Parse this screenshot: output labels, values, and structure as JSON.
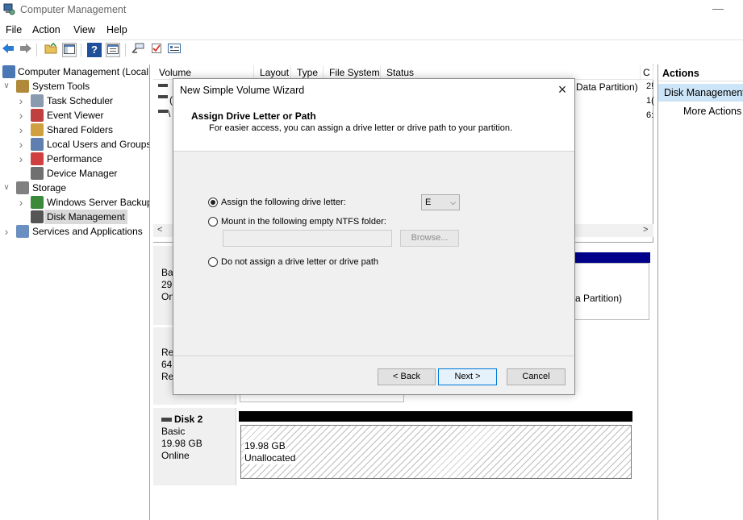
{
  "window": {
    "title": "Computer Management",
    "minimize": "—"
  },
  "menu": [
    "File",
    "Action",
    "View",
    "Help"
  ],
  "toolbar": {
    "back": "back-arrow-icon",
    "forward": "forward-arrow-icon",
    "up": "up-folder-icon",
    "show_tree": "console-tree-icon",
    "help": "help-icon",
    "view": "view-icon",
    "connect": "connect-icon",
    "check": "checklist-icon",
    "properties": "properties-icon",
    "help_glyph": "?"
  },
  "tree": {
    "root": "Computer Management (Local",
    "items": [
      {
        "label": "System Tools",
        "level": 1,
        "arrow": "v"
      },
      {
        "label": "Task Scheduler",
        "level": 2,
        "arrow": ">"
      },
      {
        "label": "Event Viewer",
        "level": 2,
        "arrow": ">"
      },
      {
        "label": "Shared Folders",
        "level": 2,
        "arrow": ">"
      },
      {
        "label": "Local Users and Groups",
        "level": 2,
        "arrow": ">"
      },
      {
        "label": "Performance",
        "level": 2,
        "arrow": ">"
      },
      {
        "label": "Device Manager",
        "level": 2,
        "arrow": ""
      },
      {
        "label": "Storage",
        "level": 1,
        "arrow": "v"
      },
      {
        "label": "Windows Server Backup",
        "level": 2,
        "arrow": ">"
      },
      {
        "label": "Disk Management",
        "level": 2,
        "arrow": "",
        "selected": true
      },
      {
        "label": "Services and Applications",
        "level": 1,
        "arrow": ">"
      }
    ]
  },
  "volume_list": {
    "columns": [
      "Volume",
      "Layout",
      "Type",
      "File System",
      "Status",
      "C"
    ],
    "visible_fragments": {
      "status_row1": "Data Partition)",
      "cap1": "2!",
      "cap2": "1(",
      "cap3": "6:",
      "vol_prefix1": "(",
      "vol_prefix2": "\\"
    }
  },
  "disk_pane": {
    "disk0": {
      "line1": "Bas",
      "line2": "29.",
      "line3": "On",
      "partition_text": "a Partition)"
    },
    "disk1": {
      "line1": "Re",
      "line2": "64",
      "line3": "Re"
    },
    "disk2": {
      "name": "Disk 2",
      "type": "Basic",
      "size": "19.98 GB",
      "status": "Online",
      "area_size": "19.98 GB",
      "area_label": "Unallocated"
    }
  },
  "actions": {
    "header": "Actions",
    "selected": "Disk Management",
    "more": "More Actions"
  },
  "dialog": {
    "title": "New Simple Volume Wizard",
    "close": "×",
    "heading": "Assign Drive Letter or Path",
    "subheading": "For easier access, you can assign a drive letter or drive path to your partition.",
    "opt_assign": "Assign the following drive letter:",
    "opt_mount": "Mount in the following empty NTFS folder:",
    "opt_none": "Do not assign a drive letter or drive path",
    "selected_option": "assign",
    "drive_letter": "E",
    "browse": "Browse...",
    "back": "< Back",
    "next": "Next >",
    "cancel": "Cancel"
  }
}
